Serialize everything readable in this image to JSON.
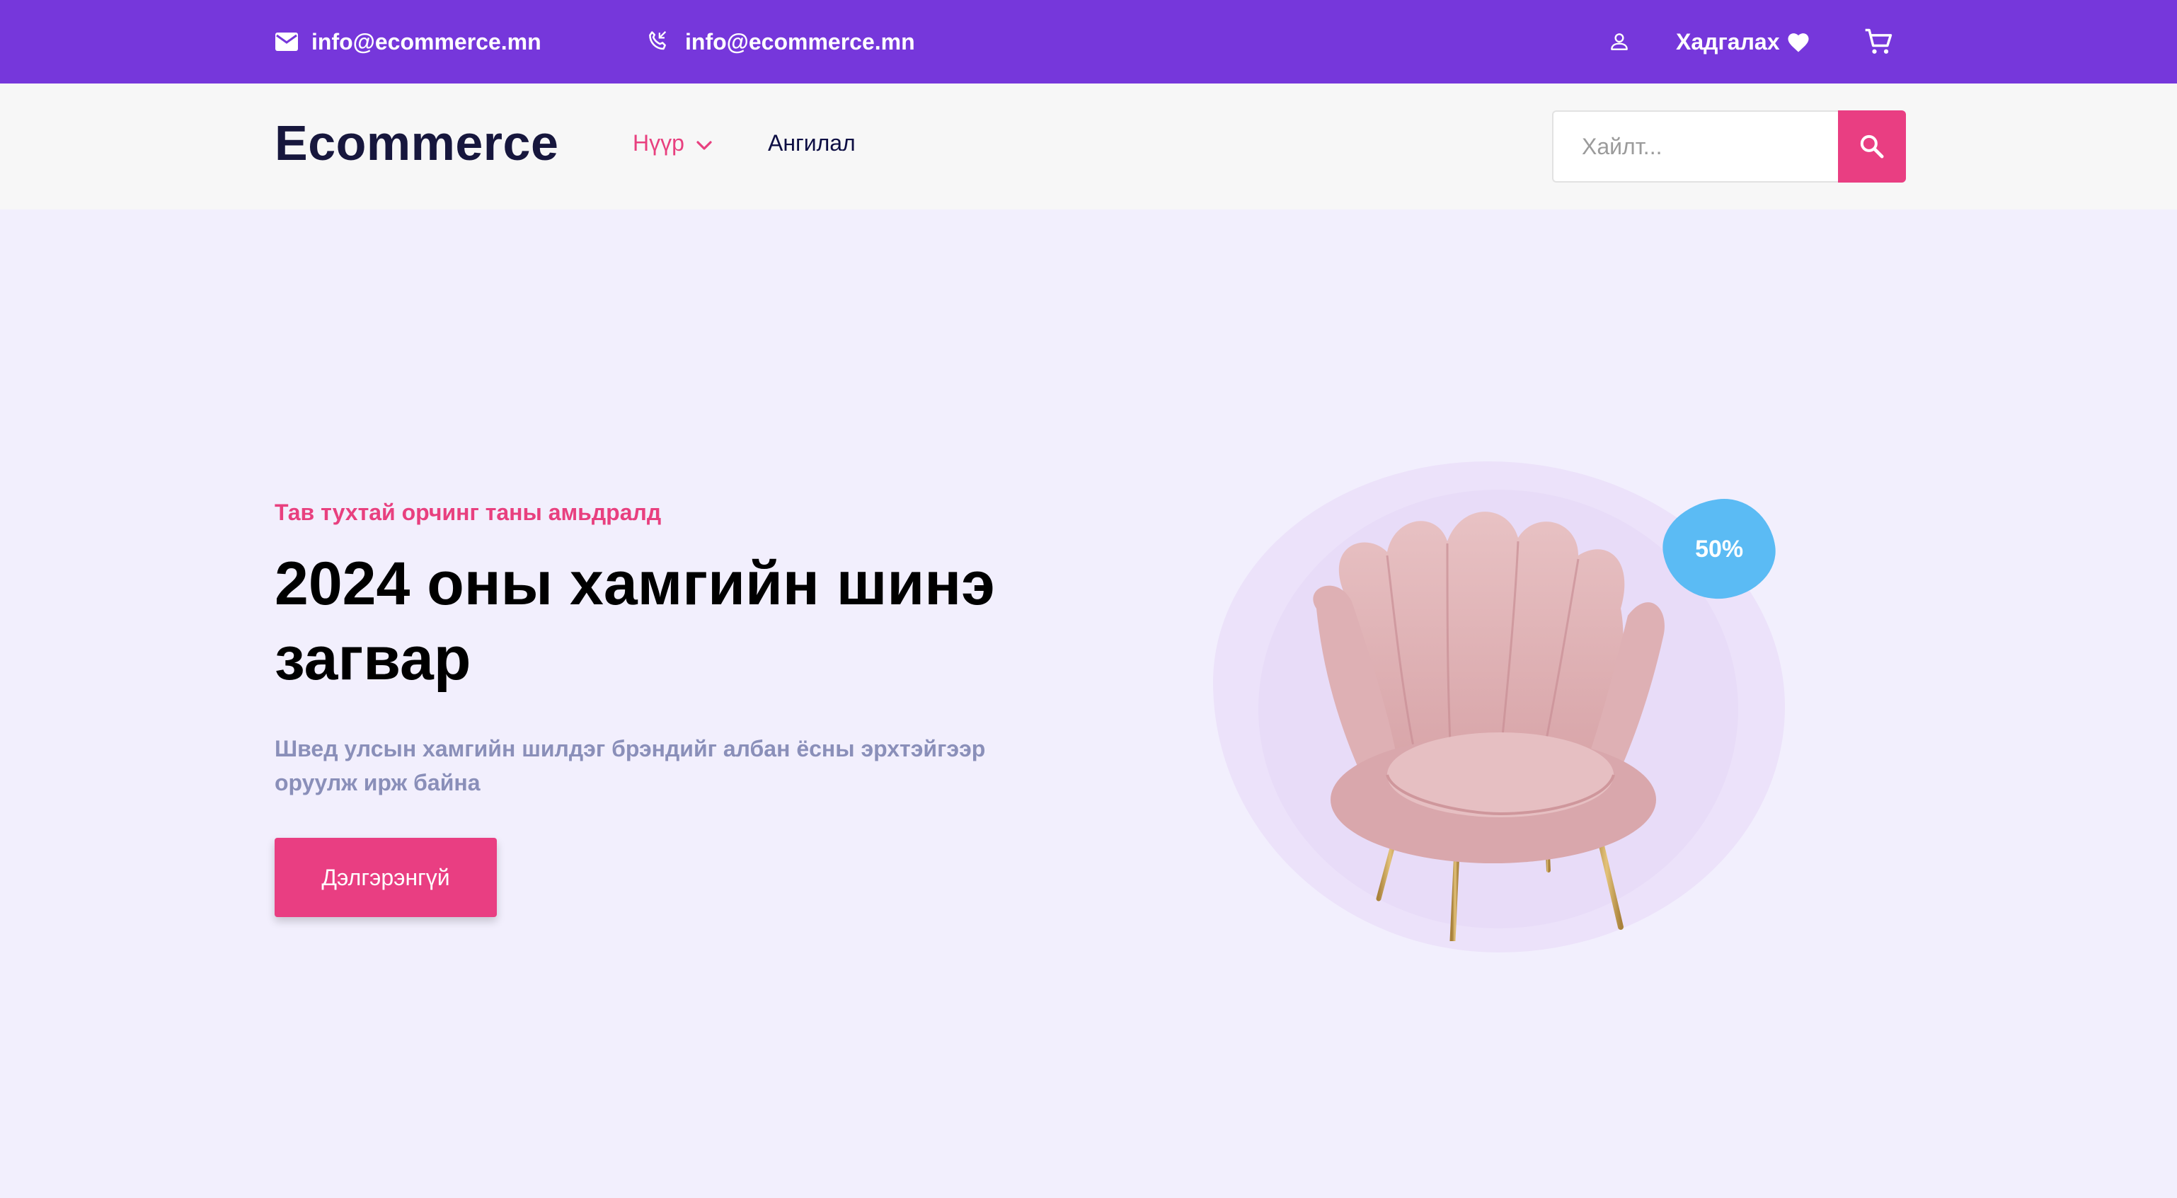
{
  "topbar": {
    "email": "info@ecommerce.mn",
    "phone": "info@ecommerce.mn",
    "wishlist_label": "Хадгалах",
    "icons": {
      "email": "mail-icon",
      "phone": "phone-icon",
      "user": "user-icon",
      "wishlist": "heart-icon",
      "cart": "cart-icon"
    }
  },
  "nav": {
    "logo": "Ecommerce",
    "home_label": "Нүүр",
    "category_label": "Ангилал",
    "search_placeholder": "Хайлт..."
  },
  "hero": {
    "subtitle": "Тав тухтай орчинг таны амьдралд",
    "title": "2024 оны хамгийн шинэ загвар",
    "description": "Швед улсын хамгийн шилдэг брэндийг албан ёсны эрхтэйгээр оруулж ирж байна",
    "button_label": "Дэлгэрэнгүй",
    "badge": "50%"
  },
  "colors": {
    "topbar": "#7637db",
    "accent": "#e93e82",
    "badge": "#5bbbf4",
    "background": "#f2effd",
    "logo": "#17173d"
  }
}
